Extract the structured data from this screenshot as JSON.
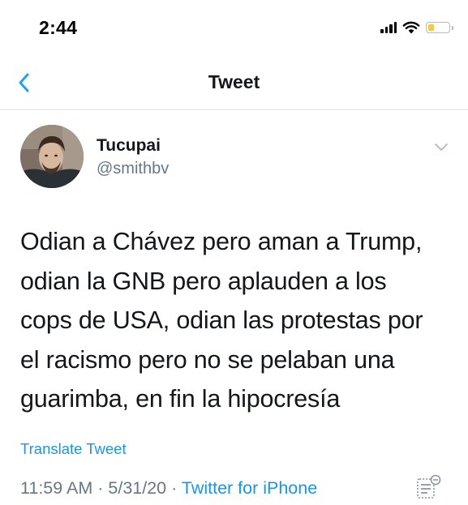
{
  "status_bar": {
    "time": "2:44",
    "battery_color": "#f6c844"
  },
  "nav": {
    "back_icon": "chevron-left-icon",
    "title": "Tweet",
    "accent_color": "#1da1f2"
  },
  "tweet": {
    "display_name": "Tucupai",
    "handle": "@smithbv",
    "text_lines": [
      "Odian a Chávez pero aman a Trump,",
      "odian la GNB pero aplauden a los",
      "cops de USA, odian las protestas por",
      "el racismo pero no se pelaban una",
      "guarimba, en fin la hipocresía"
    ],
    "translate_label": "Translate Tweet",
    "time": "11:59 AM",
    "separator": "·",
    "date": "5/31/20",
    "source": "Twitter for iPhone",
    "link_color": "#1b95e0",
    "muted_color": "#657786"
  }
}
